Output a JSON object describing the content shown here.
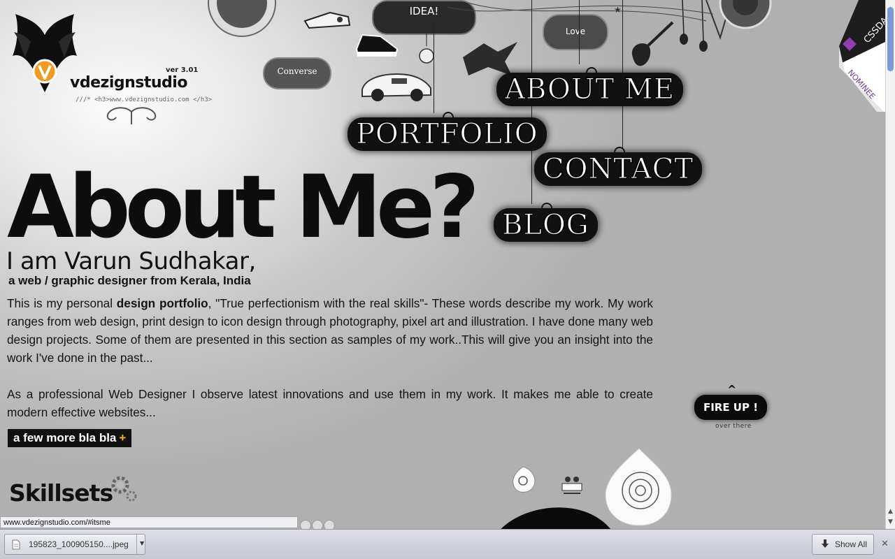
{
  "logo": {
    "version": "ver 3.01",
    "brand": "vdezignstudio",
    "tagline": "///* <h3>www.vdezignstudio.com </h3>"
  },
  "decorations": {
    "idea": "IDEA!",
    "love": "Love",
    "converse": "Converse"
  },
  "nav": {
    "about": "ABOUT ME",
    "portfolio": "PORTFOLIO",
    "contact": "CONTACT",
    "blog": "BLOG"
  },
  "cssda": {
    "top": "CSSDA",
    "bottom": "NOMINEE"
  },
  "content": {
    "headline": "About Me?",
    "name": "I am Varun Sudhakar,",
    "subtitle": "a web / graphic designer from Kerala, India",
    "para1_pre": "This is my personal ",
    "para1_bold": "design portfolio",
    "para1_post": ", \"True perfectionism with the real skills\"- These words describe my work. My work ranges from web design, print design to icon design through photography, pixel art and illustration. I have done many web design projects. Some of them are presented in this section as samples of my work..This will give you an insight into the work I've done in the past...",
    "para2": "As a professional Web Designer I observe latest innovations and use them in my work. It makes me able to create modern effective websites...",
    "more_label": "a few more bla bla",
    "more_plus": "+",
    "skills_title": "Skillsets"
  },
  "fireup": {
    "caret": "^",
    "label": "FIRE UP !",
    "sub": "over there"
  },
  "status": {
    "url": "www.vdezignstudio.com/#itsme"
  },
  "download_shelf": {
    "file_name": "195823_100905150....jpeg",
    "show_all": "Show All"
  },
  "colors": {
    "accent": "#f0b81a",
    "dark": "#111111",
    "logo_orange": "#f29a1f"
  }
}
